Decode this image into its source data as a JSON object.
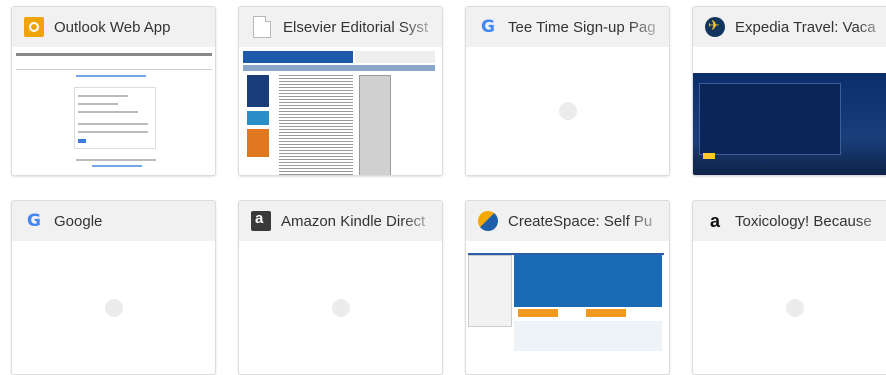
{
  "tiles": [
    {
      "title": "Outlook Web App",
      "favicon": "outlook-icon",
      "state": "thumbnail"
    },
    {
      "title": "Elsevier Editorial Syst",
      "favicon": "document-icon",
      "state": "thumbnail"
    },
    {
      "title": "Tee Time Sign-up Pag",
      "favicon": "google-g-icon",
      "state": "loading"
    },
    {
      "title": "Expedia Travel: Vaca",
      "favicon": "expedia-icon",
      "state": "thumbnail"
    },
    {
      "title": "Google",
      "favicon": "google-g-icon",
      "state": "loading"
    },
    {
      "title": "Amazon Kindle Direct",
      "favicon": "kindle-icon",
      "state": "loading"
    },
    {
      "title": "CreateSpace: Self Pu",
      "favicon": "createspace-icon",
      "state": "thumbnail"
    },
    {
      "title": "Toxicology! Because",
      "favicon": "amazon-icon",
      "state": "loading"
    }
  ],
  "colors": {
    "header_bg": "#f1f1f1",
    "border": "#dcdcdc",
    "google_blue": "#4285f4"
  }
}
